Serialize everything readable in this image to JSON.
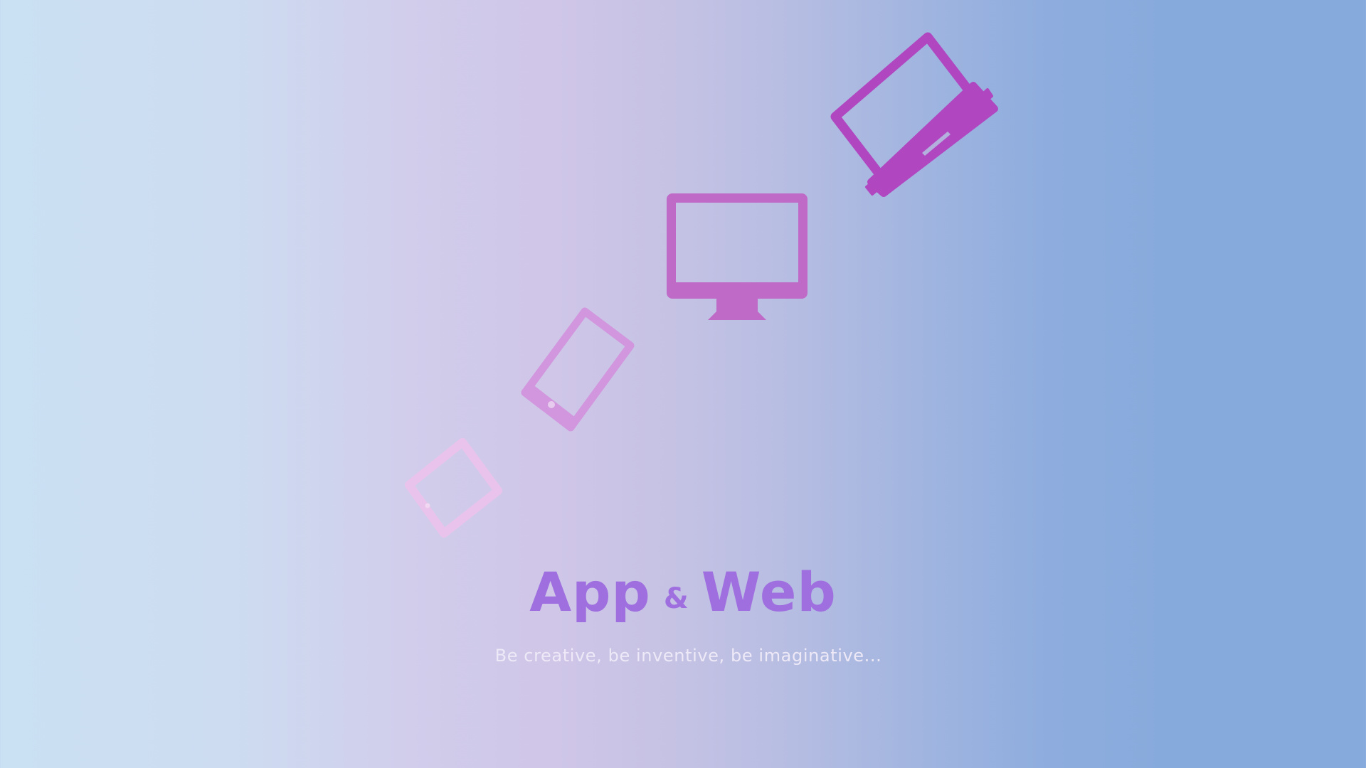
{
  "hero": {
    "title_part1": "App",
    "title_connector": "&",
    "title_part2": "Web",
    "tagline": "Be creative, be inventive, be imaginative..."
  },
  "devices": [
    {
      "icon": "laptop-icon",
      "color": "#b046c0"
    },
    {
      "icon": "desktop-monitor-icon",
      "color": "#c06ac8"
    },
    {
      "icon": "smartphone-icon",
      "color": "#d196dd"
    },
    {
      "icon": "tablet-icon",
      "color": "#eac3ec"
    }
  ],
  "colors": {
    "title": "#9f6fe0",
    "tagline": "#eee9f7",
    "background_left": "#cae0f3",
    "background_middle": "#d0c6e8",
    "background_right": "#86aadc"
  }
}
